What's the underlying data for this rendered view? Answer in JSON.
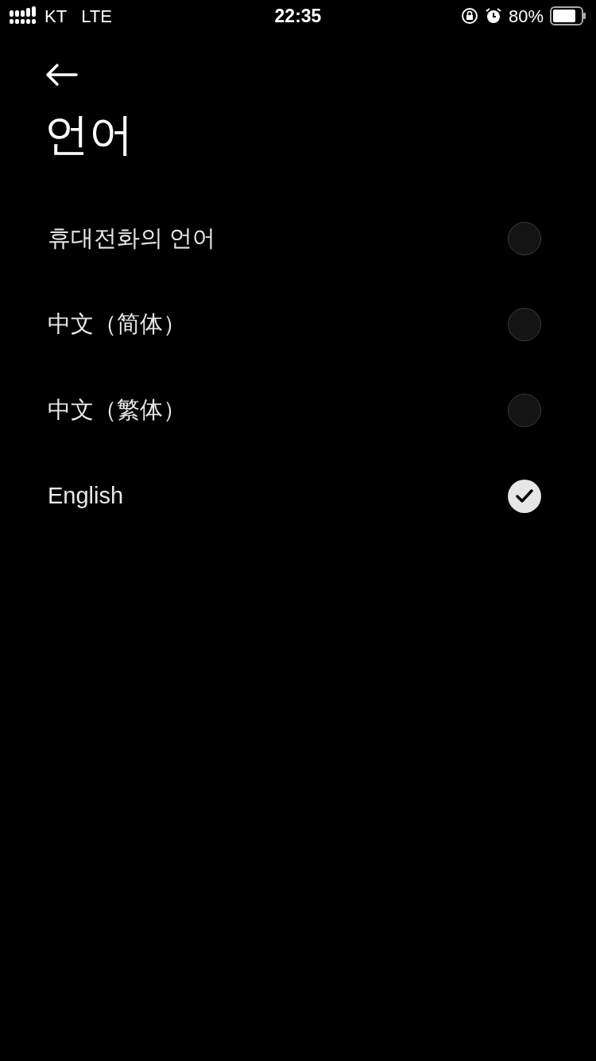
{
  "status_bar": {
    "carrier": "KT",
    "network": "LTE",
    "time": "22:35",
    "battery_percent": "80%"
  },
  "header": {
    "title": "언어"
  },
  "languages": [
    {
      "label": "휴대전화의 언어",
      "selected": false
    },
    {
      "label": "中文（简体）",
      "selected": false
    },
    {
      "label": "中文（繁体）",
      "selected": false
    },
    {
      "label": "English",
      "selected": true
    }
  ]
}
